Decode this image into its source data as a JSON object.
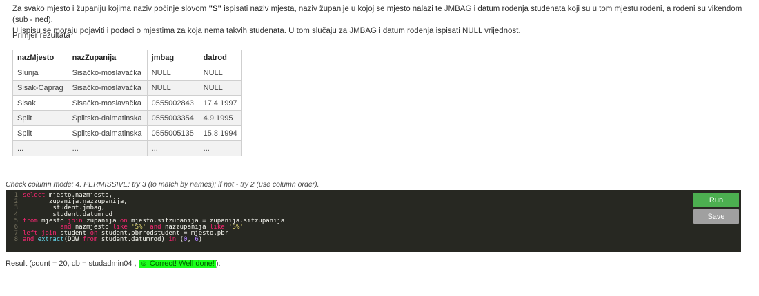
{
  "task": {
    "line1_pre": "Za svako mjesto i županiju kojima naziv počinje slovom ",
    "line1_bold": "\"S\"",
    "line1_post": " ispisati naziv mjesta, naziv županije u kojoj se mjesto nalazi te JMBAG i datum rođenja studenata koji su u tom mjestu rođeni, a rođeni su vikendom (sub - ned).",
    "line2": "U ispisu se moraju pojaviti i podaci o mjestima za koja nema takvih studenata. U tom slučaju za JMBAG i datum rođenja ispisati NULL vrijednost."
  },
  "example": {
    "label": "Primjer rezultata",
    "columns": [
      "nazMjesto",
      "nazZupanija",
      "jmbag",
      "datrod"
    ],
    "rows": [
      [
        "Slunja",
        "Sisačko-moslavačka",
        "NULL",
        "NULL"
      ],
      [
        "Sisak-Caprag",
        "Sisačko-moslavačka",
        "NULL",
        "NULL"
      ],
      [
        "Sisak",
        "Sisačko-moslavačka",
        "0555002843",
        "17.4.1997"
      ],
      [
        "Split",
        "Splitsko-dalmatinska",
        "0555003354",
        "4.9.1995"
      ],
      [
        "Split",
        "Splitsko-dalmatinska",
        "0555005135",
        "15.8.1994"
      ],
      [
        "...",
        "...",
        "...",
        "..."
      ]
    ]
  },
  "check_mode": "Check column mode: 4. PERMISSIVE: try 3 (to match by names); if not - try 2 (use column order).",
  "editor": {
    "line_numbers": [
      "1",
      "2",
      "3",
      "4",
      "5",
      "6",
      "7",
      "8"
    ]
  },
  "buttons": {
    "run": "Run",
    "save": "Save"
  },
  "result": {
    "prefix": "Result (count = 20, db = studadmin04 , ",
    "correct": "☺ Correct! Well done!",
    "suffix": "):"
  },
  "colors": {
    "editor_bg": "#272822",
    "run_button": "#4caf50",
    "save_button": "#a0a0a0",
    "correct_highlight": "#1aff1a"
  }
}
